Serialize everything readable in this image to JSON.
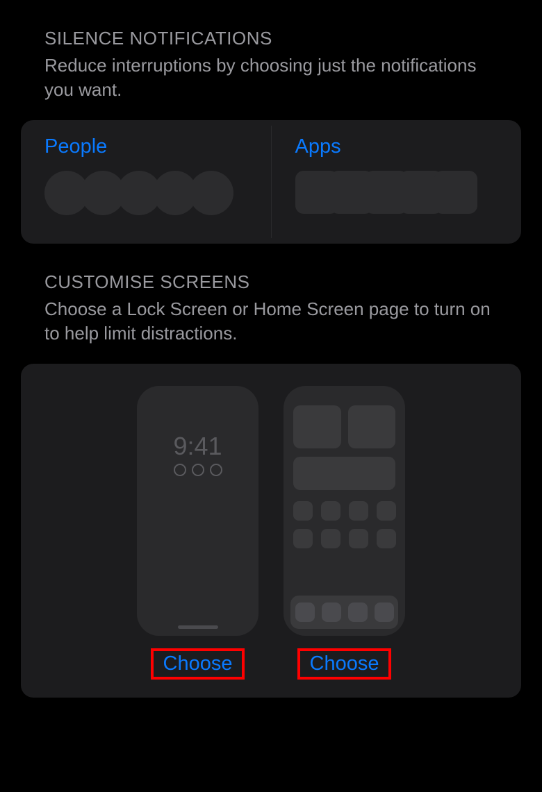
{
  "sections": {
    "silence": {
      "title": "SILENCE NOTIFICATIONS",
      "desc": "Reduce interruptions by choosing just the notifications you want.",
      "people_label": "People",
      "apps_label": "Apps"
    },
    "customise": {
      "title": "CUSTOMISE SCREENS",
      "desc": "Choose a Lock Screen or Home Screen page to turn on to help limit distractions.",
      "lock": {
        "time": "9:41",
        "choose_label": "Choose"
      },
      "home": {
        "choose_label": "Choose"
      }
    }
  }
}
